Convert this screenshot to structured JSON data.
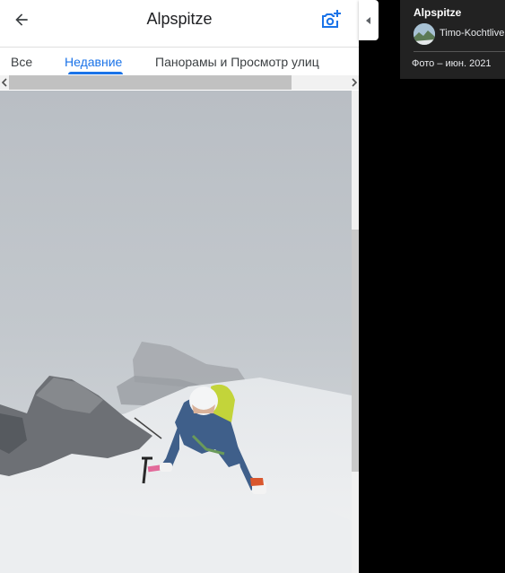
{
  "header": {
    "title": "Alpspitze",
    "back_icon": "arrow-back-icon",
    "camera_icon": "add-photo-icon"
  },
  "tabs": [
    {
      "label": "Все",
      "active": false
    },
    {
      "label": "Недавние",
      "active": true
    },
    {
      "label": "Панорамы и Просмотр улиц",
      "active": false
    }
  ],
  "photo": {
    "description_icon": "climber-photo"
  },
  "info_card": {
    "title": "Alpspitze",
    "author": "Timo-Kochtlive",
    "date": "Фото – июн. 2021"
  },
  "colors": {
    "accent": "#1a73e8",
    "card_bg": "#222222",
    "page_bg": "#000000"
  }
}
